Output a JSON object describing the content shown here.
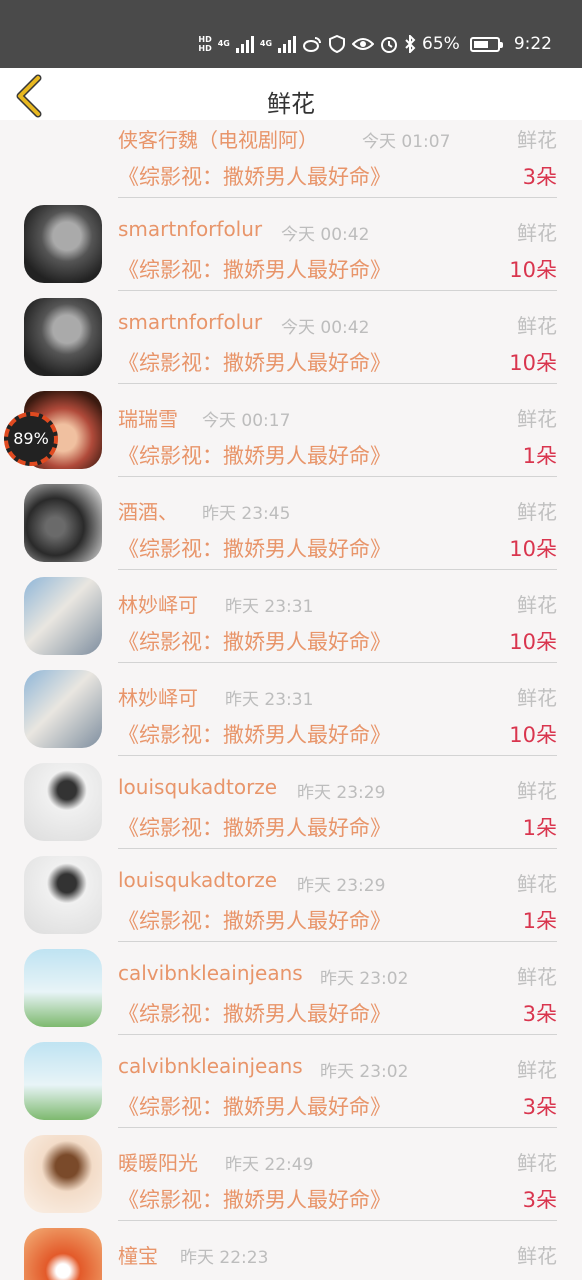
{
  "status_bar": {
    "network_label": "4G",
    "hd_label": "HD",
    "battery": "65%",
    "battery_level": 0.65,
    "time": "9:22",
    "icons": [
      "hd-icon",
      "signal-icon",
      "signal-icon",
      "weibo-icon",
      "shield-icon",
      "eye-icon",
      "alarm-icon",
      "bluetooth-icon",
      "battery-icon"
    ]
  },
  "nav": {
    "back_icon": "chevron-left-icon",
    "title": "鲜花"
  },
  "floating_badge": {
    "value": "89%"
  },
  "gifts": [
    {
      "user": "侠客行魏（电视剧阿）",
      "time": "今天 01:07",
      "gift": "鲜花",
      "show": "《综影视：撒娇男人最好命》",
      "count": "3朵",
      "avatar": "none"
    },
    {
      "user": "smartnforfolur",
      "time": "今天 00:42",
      "gift": "鲜花",
      "show": "《综影视：撒娇男人最好命》",
      "count": "10朵",
      "avatar": "a1"
    },
    {
      "user": "smartnforfolur",
      "time": "今天 00:42",
      "gift": "鲜花",
      "show": "《综影视：撒娇男人最好命》",
      "count": "10朵",
      "avatar": "a1"
    },
    {
      "user": "瑞瑞雪",
      "time": "今天 00:17",
      "gift": "鲜花",
      "show": "《综影视：撒娇男人最好命》",
      "count": "1朵",
      "avatar": "a2"
    },
    {
      "user": "酒酒、",
      "time": "昨天 23:45",
      "gift": "鲜花",
      "show": "《综影视：撒娇男人最好命》",
      "count": "10朵",
      "avatar": "a3"
    },
    {
      "user": "林妙峄可",
      "time": "昨天 23:31",
      "gift": "鲜花",
      "show": "《综影视：撒娇男人最好命》",
      "count": "10朵",
      "avatar": "a4"
    },
    {
      "user": "林妙峄可",
      "time": "昨天 23:31",
      "gift": "鲜花",
      "show": "《综影视：撒娇男人最好命》",
      "count": "10朵",
      "avatar": "a4"
    },
    {
      "user": "louisqukadtorze",
      "time": "昨天 23:29",
      "gift": "鲜花",
      "show": "《综影视：撒娇男人最好命》",
      "count": "1朵",
      "avatar": "a5"
    },
    {
      "user": "louisqukadtorze",
      "time": "昨天 23:29",
      "gift": "鲜花",
      "show": "《综影视：撒娇男人最好命》",
      "count": "1朵",
      "avatar": "a5"
    },
    {
      "user": "calvibnkleainjeans",
      "time": "昨天 23:02",
      "gift": "鲜花",
      "show": "《综影视：撒娇男人最好命》",
      "count": "3朵",
      "avatar": "a6"
    },
    {
      "user": "calvibnkleainjeans",
      "time": "昨天 23:02",
      "gift": "鲜花",
      "show": "《综影视：撒娇男人最好命》",
      "count": "3朵",
      "avatar": "a6"
    },
    {
      "user": "暖暖阳光",
      "time": "昨天 22:49",
      "gift": "鲜花",
      "show": "《综影视：撒娇男人最好命》",
      "count": "3朵",
      "avatar": "a7"
    },
    {
      "user": "橦宝",
      "time": "昨天 22:23",
      "gift": "鲜花",
      "show": "",
      "count": "",
      "avatar": "a8"
    }
  ],
  "colors": {
    "accent": "#e8956a",
    "count": "#d9354e",
    "muted": "#bdbdbd",
    "back_arrow": "#e8b820"
  }
}
